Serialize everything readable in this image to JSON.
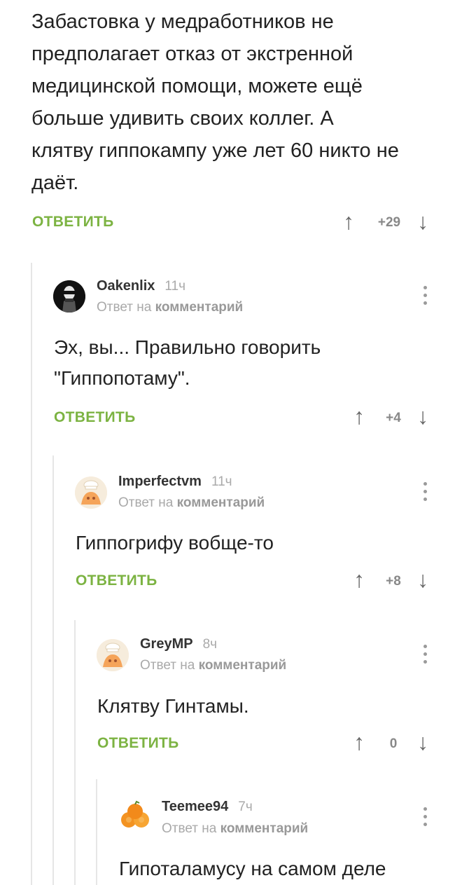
{
  "root": {
    "text_lines": [
      "Забастовка у медработников не",
      "предполагает отказ от экстренной",
      "медицинской помощи, можете ещё",
      "больше удивить своих коллег. А",
      "клятву гиппокампу уже лет 60 никто не",
      "даёт."
    ],
    "reply_label": "ОТВЕТИТЬ",
    "score": "+29"
  },
  "comments": [
    {
      "username": "Oakenlix",
      "time": "11ч",
      "sub_prefix": "Ответ на",
      "sub_link": "комментарий",
      "text_lines": [
        "Эх, вы... Правильно говорить",
        "\"Гиппопотаму\"."
      ],
      "reply_label": "ОТВЕТИТЬ",
      "score": "+4"
    },
    {
      "username": "Imperfectvm",
      "time": "11ч",
      "sub_prefix": "Ответ на",
      "sub_link": "комментарий",
      "text_lines": [
        "Гиппогрифу вобще-то"
      ],
      "reply_label": "ОТВЕТИТЬ",
      "score": "+8"
    },
    {
      "username": "GreyMP",
      "time": "8ч",
      "sub_prefix": "Ответ на",
      "sub_link": "комментарий",
      "text_lines": [
        "Клятву Гинтамы."
      ],
      "reply_label": "ОТВЕТИТЬ",
      "score": "0"
    },
    {
      "username": "Teemee94",
      "time": "7ч",
      "sub_prefix": "Ответ на",
      "sub_link": "комментарий",
      "text_lines": [
        "Гипоталамусу на самом деле"
      ]
    }
  ],
  "icons": {
    "upvote": "arrow-up-icon",
    "downvote": "arrow-down-icon",
    "menu": "more-vertical-icon"
  },
  "colors": {
    "accent_green": "#7cb342",
    "thread_line": "#e6e6e6"
  }
}
